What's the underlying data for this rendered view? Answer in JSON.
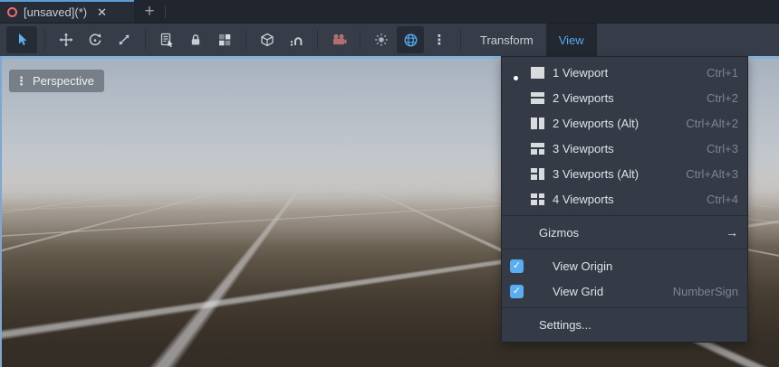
{
  "tab_bar": {
    "active_tab": {
      "title": "[unsaved](*)",
      "close_glyph": "✕"
    },
    "new_tab_glyph": "+"
  },
  "toolbar": {
    "tools": [
      "select-tool",
      "move-tool",
      "rotate-tool",
      "scale-tool",
      "list-select-tool",
      "lock-tool",
      "group-tool",
      "mesh-tool",
      "snap-tool",
      "camera-preview",
      "environment-toggle",
      "world-toggle",
      "more-options"
    ],
    "transform_menu_label": "Transform",
    "view_menu_label": "View"
  },
  "viewport": {
    "projection_label": "Perspective",
    "dots_glyph": "⋮"
  },
  "view_menu_dropdown": {
    "items": [
      {
        "type": "radio",
        "selected": true,
        "icon": "viewport-1-icon",
        "label": "1 Viewport",
        "shortcut": "Ctrl+1"
      },
      {
        "type": "radio",
        "selected": false,
        "icon": "viewport-2-icon",
        "label": "2 Viewports",
        "shortcut": "Ctrl+2"
      },
      {
        "type": "radio",
        "selected": false,
        "icon": "viewport-2-alt-icon",
        "label": "2 Viewports (Alt)",
        "shortcut": "Ctrl+Alt+2"
      },
      {
        "type": "radio",
        "selected": false,
        "icon": "viewport-3-icon",
        "label": "3 Viewports",
        "shortcut": "Ctrl+3"
      },
      {
        "type": "radio",
        "selected": false,
        "icon": "viewport-3-alt-icon",
        "label": "3 Viewports (Alt)",
        "shortcut": "Ctrl+Alt+3"
      },
      {
        "type": "radio",
        "selected": false,
        "icon": "viewport-4-icon",
        "label": "4 Viewports",
        "shortcut": "Ctrl+4"
      },
      {
        "type": "submenu",
        "label": "Gizmos",
        "arrow_glyph": "→"
      },
      {
        "type": "checkbox",
        "checked": true,
        "label": "View Origin",
        "shortcut": "",
        "check_glyph": "✓"
      },
      {
        "type": "checkbox",
        "checked": true,
        "label": "View Grid",
        "shortcut": "NumberSign",
        "check_glyph": "✓"
      },
      {
        "type": "action",
        "label": "Settings..."
      }
    ]
  },
  "colors": {
    "accent_blue": "#5aa9f0",
    "tab_highlight": "#5b9ed7",
    "camera_icon_pink": "#b26f72",
    "scene_icon_red": "#ef6a6a",
    "menu_bg": "#343b47",
    "toolbar_bg": "#363d49"
  }
}
